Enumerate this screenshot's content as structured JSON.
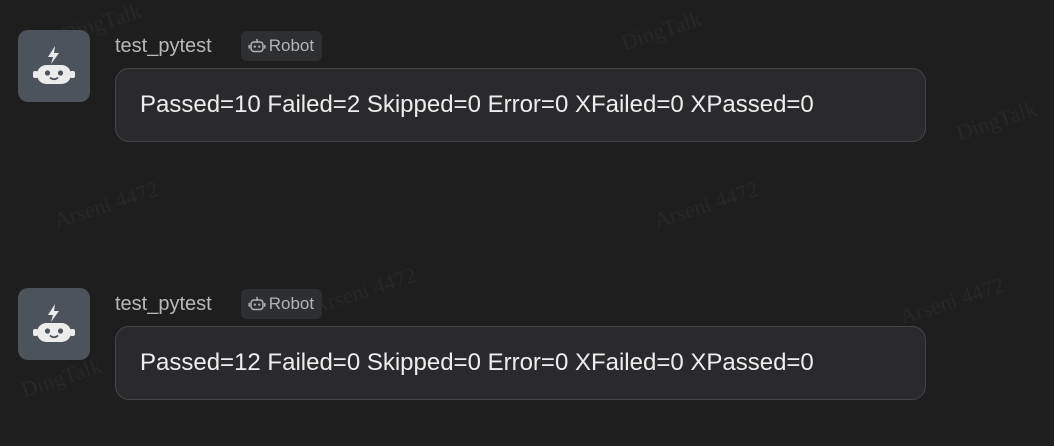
{
  "watermarks": {
    "brand": "DingTalk",
    "user": "Arseni 4472"
  },
  "messages": [
    {
      "sender": "test_pytest",
      "badge": "Robot",
      "text": "Passed=10 Failed=2 Skipped=0 Error=0 XFailed=0 XPassed=0",
      "avatar_icon": "robot-avatar-icon"
    },
    {
      "sender": "test_pytest",
      "badge": "Robot",
      "text": "Passed=12 Failed=0 Skipped=0 Error=0 XFailed=0 XPassed=0",
      "avatar_icon": "robot-avatar-icon"
    }
  ],
  "colors": {
    "background": "#1e1e1f",
    "avatar_bg": "#4d535b",
    "bubble_bg": "#2a2a2c",
    "bubble_border": "#444548",
    "message_text": "#ededee",
    "sender_text": "#b7b8ba"
  }
}
